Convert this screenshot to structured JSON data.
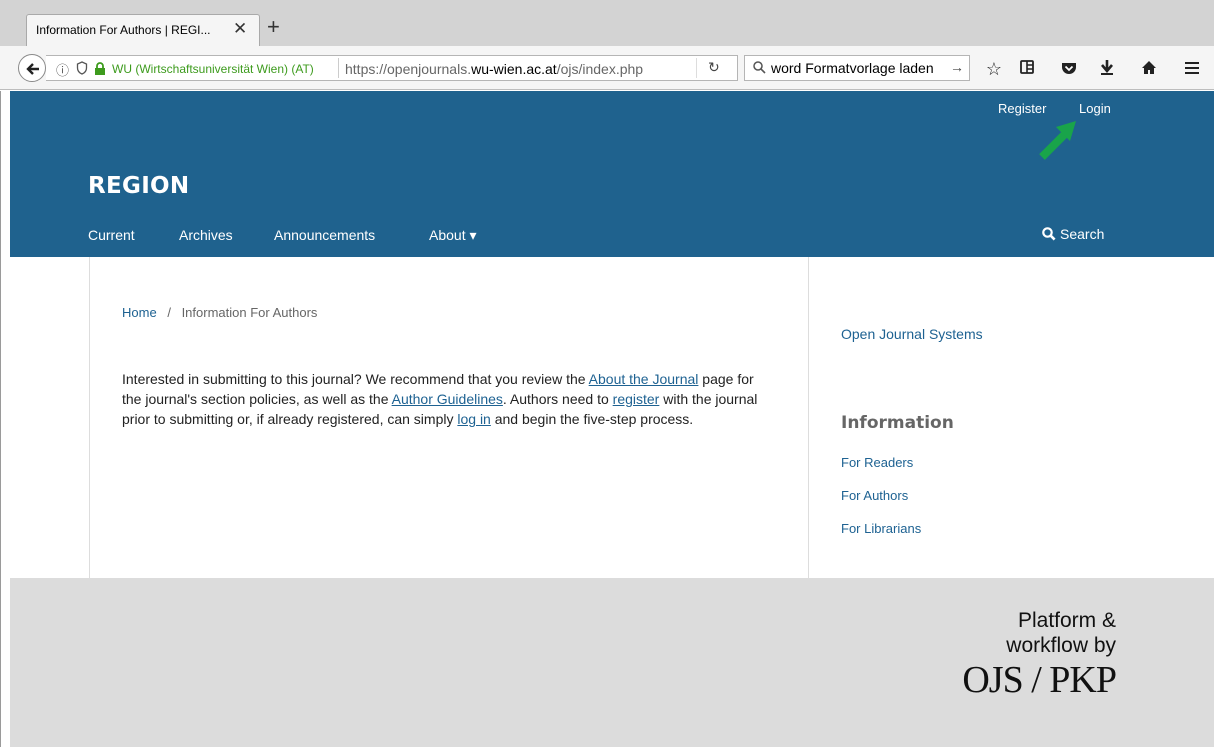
{
  "browser": {
    "tab_title": "Information For Authors | REGI...",
    "tab_close": "✕",
    "new_tab": "+",
    "identity": "WU (Wirtschaftsuniversität Wien) (AT)",
    "url_prefix": "https://openjournals.",
    "url_domain": "wu-wien.ac.at",
    "url_suffix": "/ojs/index.php",
    "search_text": "word Formatvorlage laden",
    "colors": {
      "identity": "#3d9b1d"
    }
  },
  "header": {
    "register": "Register",
    "login": "Login",
    "site_title": "REGION",
    "nav": [
      "Current",
      "Archives",
      "Announcements",
      "About ▾"
    ],
    "search": "Search",
    "colors": {
      "background": "#1f628e",
      "arrow": "#19a44a"
    }
  },
  "main": {
    "breadcrumb_home": "Home",
    "breadcrumb_sep": "/",
    "breadcrumb_current": "Information For Authors",
    "intro": {
      "p1": "Interested in submitting to this journal? We recommend that you review the ",
      "link_about": "About the Journal",
      "p2": " page for the journal's section policies, as well as the ",
      "link_guidelines": "Author Guidelines",
      "p3": ". Authors need to ",
      "link_register": "register",
      "p4": " with the journal prior to submitting or, if already registered, can simply ",
      "link_login": "log in",
      "p5": " and begin the five-step process."
    }
  },
  "sidebar": {
    "ojs_link": "Open Journal Systems",
    "info_title": "Information",
    "links": [
      "For Readers",
      "For Authors",
      "For Librarians"
    ]
  },
  "footer": {
    "line1": "Platform &",
    "line2": "workflow by",
    "logo": "OJS / PKP"
  }
}
